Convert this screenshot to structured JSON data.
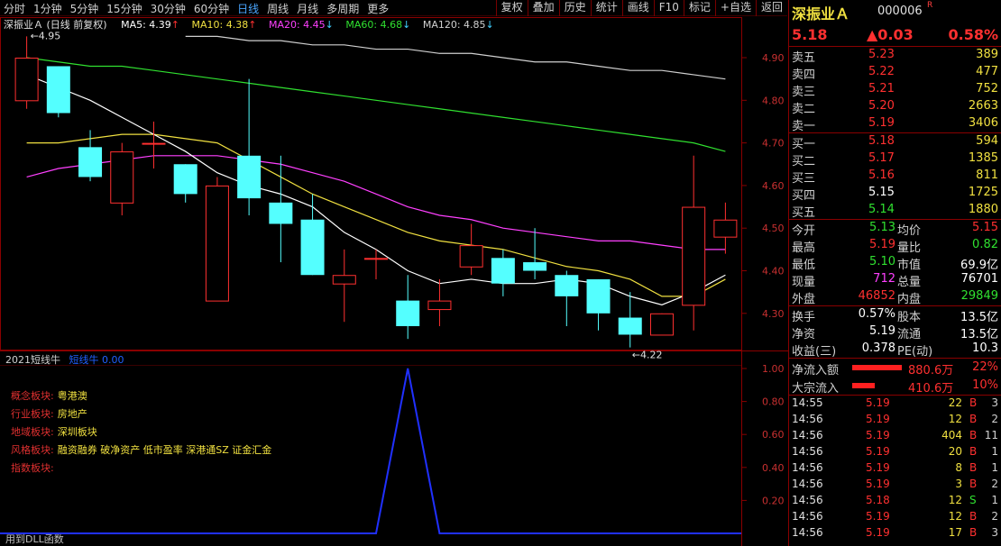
{
  "toolbar": {
    "periods": [
      "分时",
      "1分钟",
      "5分钟",
      "15分钟",
      "30分钟",
      "60分钟",
      "日线",
      "周线",
      "月线",
      "多周期",
      "更多"
    ],
    "active_period": "日线",
    "buttons": [
      "复权",
      "叠加",
      "历史",
      "统计",
      "画线",
      "F10",
      "标记",
      "+自选",
      "返回"
    ]
  },
  "chart_header": {
    "title": "深振业Ａ (日线 前复权)",
    "ma5": "MA5: 4.39",
    "ma10": "MA10: 4.38",
    "ma20": "MA20: 4.45",
    "ma60": "MA60: 4.68",
    "ma120": "MA120: 4.85"
  },
  "colors": {
    "up": "#ff3030",
    "down": "#54ffff",
    "ma5": "#ffffff",
    "ma10": "#f0e040",
    "ma20": "#ff40ff",
    "ma60": "#30e030",
    "ma120": "#d0d0d0",
    "indicator": "#2030ff"
  },
  "chart_data": {
    "type": "candlestick",
    "y_ticks": [
      "4.90",
      "4.80",
      "4.70",
      "4.60",
      "4.50",
      "4.40",
      "4.30"
    ],
    "ylim": [
      4.215,
      4.955
    ],
    "candles": [
      {
        "o": 4.8,
        "h": 4.95,
        "l": 4.78,
        "c": 4.9
      },
      {
        "o": 4.88,
        "h": 4.88,
        "l": 4.76,
        "c": 4.77
      },
      {
        "o": 4.69,
        "h": 4.73,
        "l": 4.61,
        "c": 4.62
      },
      {
        "o": 4.56,
        "h": 4.7,
        "l": 4.53,
        "c": 4.68
      },
      {
        "o": 4.7,
        "h": 4.75,
        "l": 4.64,
        "c": 4.7
      },
      {
        "o": 4.65,
        "h": 4.65,
        "l": 4.56,
        "c": 4.58
      },
      {
        "o": 4.33,
        "h": 4.62,
        "l": 4.33,
        "c": 4.6
      },
      {
        "o": 4.67,
        "h": 4.85,
        "l": 4.53,
        "c": 4.57
      },
      {
        "o": 4.56,
        "h": 4.67,
        "l": 4.42,
        "c": 4.51
      },
      {
        "o": 4.52,
        "h": 4.58,
        "l": 4.39,
        "c": 4.39
      },
      {
        "o": 4.37,
        "h": 4.45,
        "l": 4.28,
        "c": 4.39
      },
      {
        "o": 4.43,
        "h": 4.45,
        "l": 4.38,
        "c": 4.43
      },
      {
        "o": 4.33,
        "h": 4.39,
        "l": 4.24,
        "c": 4.27
      },
      {
        "o": 4.31,
        "h": 4.38,
        "l": 4.27,
        "c": 4.33
      },
      {
        "o": 4.41,
        "h": 4.51,
        "l": 4.39,
        "c": 4.46
      },
      {
        "o": 4.43,
        "h": 4.45,
        "l": 4.34,
        "c": 4.37
      },
      {
        "o": 4.42,
        "h": 4.5,
        "l": 4.38,
        "c": 4.4
      },
      {
        "o": 4.39,
        "h": 4.4,
        "l": 4.27,
        "c": 4.34
      },
      {
        "o": 4.38,
        "h": 4.38,
        "l": 4.26,
        "c": 4.3
      },
      {
        "o": 4.29,
        "h": 4.35,
        "l": 4.22,
        "c": 4.25
      },
      {
        "o": 4.25,
        "h": 4.3,
        "l": 4.25,
        "c": 4.3
      },
      {
        "o": 4.32,
        "h": 4.67,
        "l": 4.26,
        "c": 4.55
      },
      {
        "o": 4.48,
        "h": 4.56,
        "l": 4.44,
        "c": 4.52
      }
    ],
    "ma5_series": [
      4.86,
      4.83,
      4.8,
      4.76,
      4.72,
      4.68,
      4.63,
      4.6,
      4.58,
      4.55,
      4.49,
      4.45,
      4.4,
      4.37,
      4.38,
      4.37,
      4.37,
      4.38,
      4.37,
      4.34,
      4.32,
      4.35,
      4.39
    ],
    "ma10_series": [
      4.7,
      4.7,
      4.71,
      4.72,
      4.72,
      4.71,
      4.7,
      4.66,
      4.62,
      4.58,
      4.55,
      4.52,
      4.49,
      4.47,
      4.46,
      4.45,
      4.43,
      4.41,
      4.4,
      4.38,
      4.34,
      4.34,
      4.38
    ],
    "ma20_series": [
      4.62,
      4.64,
      4.65,
      4.66,
      4.67,
      4.67,
      4.67,
      4.66,
      4.65,
      4.63,
      4.61,
      4.58,
      4.55,
      4.53,
      4.52,
      4.5,
      4.49,
      4.48,
      4.47,
      4.47,
      4.46,
      4.45,
      4.45
    ],
    "ma60_series": [
      4.9,
      4.89,
      4.88,
      4.88,
      4.87,
      4.86,
      4.85,
      4.84,
      4.83,
      4.82,
      4.81,
      4.8,
      4.79,
      4.78,
      4.77,
      4.76,
      4.75,
      4.74,
      4.73,
      4.72,
      4.71,
      4.7,
      4.68
    ],
    "ma120_series": [
      null,
      null,
      null,
      null,
      null,
      4.95,
      4.95,
      4.94,
      4.94,
      4.93,
      4.93,
      4.92,
      4.92,
      4.91,
      4.91,
      4.9,
      4.89,
      4.89,
      4.88,
      4.87,
      4.87,
      4.86,
      4.85
    ],
    "high_label": "4.95",
    "low_label": "4.22",
    "indicator": {
      "name": "2021短线牛",
      "line_name": "短线牛",
      "line_value": "0.00",
      "y_ticks": [
        "1.00",
        "0.80",
        "0.60",
        "0.40",
        "0.20"
      ],
      "ylim": [
        0,
        1
      ],
      "values": [
        0,
        0,
        0,
        0,
        0,
        0,
        0,
        0,
        0,
        0,
        0,
        0,
        1,
        0,
        0,
        0,
        0,
        0,
        0,
        0,
        0,
        0,
        0
      ]
    }
  },
  "sectors": [
    {
      "key": "概念板块:",
      "value": "粤港澳"
    },
    {
      "key": "行业板块:",
      "value": "房地产"
    },
    {
      "key": "地域板块:",
      "value": "深圳板块"
    },
    {
      "key": "风格板块:",
      "value": "融资融券 破净资产 低市盈率 深港通SZ 证金汇金"
    },
    {
      "key": "指数板块:",
      "value": ""
    }
  ],
  "footer": "用到DLL函数",
  "panel": {
    "name": "深振业Ａ",
    "code": "000006",
    "badge": "R",
    "price": "5.18",
    "change": "▲0.03",
    "change_pct": "0.58%",
    "asks": [
      {
        "label": "卖五",
        "price": "5.23",
        "vol": "389",
        "pc": "red"
      },
      {
        "label": "卖四",
        "price": "5.22",
        "vol": "477",
        "pc": "red"
      },
      {
        "label": "卖三",
        "price": "5.21",
        "vol": "752",
        "pc": "red"
      },
      {
        "label": "卖二",
        "price": "5.20",
        "vol": "2663",
        "pc": "red"
      },
      {
        "label": "卖一",
        "price": "5.19",
        "vol": "3406",
        "pc": "red"
      }
    ],
    "bids": [
      {
        "label": "买一",
        "price": "5.18",
        "vol": "594",
        "pc": "red"
      },
      {
        "label": "买二",
        "price": "5.17",
        "vol": "1385",
        "pc": "red"
      },
      {
        "label": "买三",
        "price": "5.16",
        "vol": "811",
        "pc": "red"
      },
      {
        "label": "买四",
        "price": "5.15",
        "vol": "1725",
        "pc": "white"
      },
      {
        "label": "买五",
        "price": "5.14",
        "vol": "1880",
        "pc": "green"
      }
    ],
    "stats1": [
      {
        "l1": "今开",
        "v1": "5.13",
        "c1": "green",
        "l2": "均价",
        "v2": "5.15",
        "c2": "red"
      },
      {
        "l1": "最高",
        "v1": "5.19",
        "c1": "red",
        "l2": "量比",
        "v2": "0.82",
        "c2": "green"
      },
      {
        "l1": "最低",
        "v1": "5.10",
        "c1": "green",
        "l2": "市值",
        "v2": "69.9亿",
        "c2": "white"
      },
      {
        "l1": "现量",
        "v1": "712",
        "c1": "magenta",
        "l2": "总量",
        "v2": "76701",
        "c2": "white"
      },
      {
        "l1": "外盘",
        "v1": "46852",
        "c1": "red",
        "l2": "内盘",
        "v2": "29849",
        "c2": "green"
      }
    ],
    "stats2": [
      {
        "l1": "换手",
        "v1": "0.57%",
        "c1": "white",
        "l2": "股本",
        "v2": "13.5亿",
        "c2": "white"
      },
      {
        "l1": "净资",
        "v1": "5.19",
        "c1": "white",
        "l2": "流通",
        "v2": "13.5亿",
        "c2": "white"
      },
      {
        "l1": "收益(三)",
        "v1": "0.378",
        "c1": "white",
        "l2": "PE(动)",
        "v2": "10.3",
        "c2": "white"
      }
    ],
    "flows": [
      {
        "label": "净流入额",
        "value": "880.6万",
        "pct": "22%",
        "bar": 0.22
      },
      {
        "label": "大宗流入",
        "value": "410.6万",
        "pct": "10%",
        "bar": 0.1
      }
    ],
    "ticks": [
      {
        "t": "14:55",
        "p": "5.19",
        "v": "22",
        "bs": "B",
        "bc": "red",
        "n": "3"
      },
      {
        "t": "14:56",
        "p": "5.19",
        "v": "12",
        "bs": "B",
        "bc": "red",
        "n": "2"
      },
      {
        "t": "14:56",
        "p": "5.19",
        "v": "404",
        "bs": "B",
        "bc": "red",
        "n": "11"
      },
      {
        "t": "14:56",
        "p": "5.19",
        "v": "20",
        "bs": "B",
        "bc": "red",
        "n": "1"
      },
      {
        "t": "14:56",
        "p": "5.19",
        "v": "8",
        "bs": "B",
        "bc": "red",
        "n": "1"
      },
      {
        "t": "14:56",
        "p": "5.19",
        "v": "3",
        "bs": "B",
        "bc": "red",
        "n": "2"
      },
      {
        "t": "14:56",
        "p": "5.18",
        "v": "12",
        "bs": "S",
        "bc": "green",
        "n": "1"
      },
      {
        "t": "14:56",
        "p": "5.19",
        "v": "12",
        "bs": "B",
        "bc": "red",
        "n": "2"
      },
      {
        "t": "14:56",
        "p": "5.19",
        "v": "17",
        "bs": "B",
        "bc": "red",
        "n": "3"
      }
    ]
  }
}
